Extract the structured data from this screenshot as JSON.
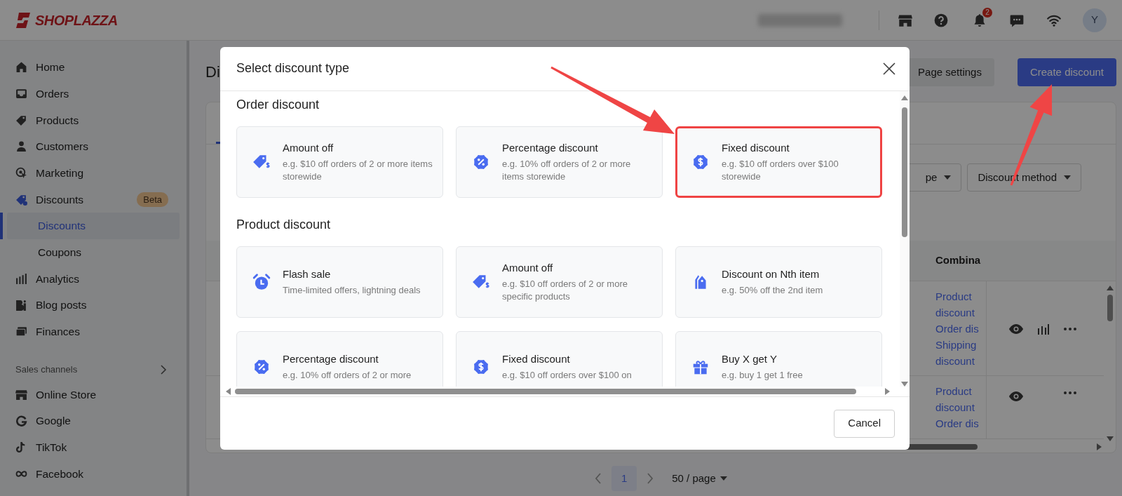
{
  "topbar": {
    "logo": "SHOPLAZZA",
    "notification_count": "2",
    "avatar": "Y"
  },
  "sidebar": {
    "items": [
      {
        "label": "Home",
        "selected": false
      },
      {
        "label": "Orders",
        "selected": false
      },
      {
        "label": "Products",
        "selected": false
      },
      {
        "label": "Customers",
        "selected": false
      },
      {
        "label": "Marketing",
        "selected": false
      },
      {
        "label": "Discounts",
        "selected": false,
        "badge": "Beta",
        "children": [
          {
            "label": "Discounts",
            "selected": true
          },
          {
            "label": "Coupons",
            "selected": false
          }
        ]
      },
      {
        "label": "Analytics",
        "selected": false
      },
      {
        "label": "Blog posts",
        "selected": false
      },
      {
        "label": "Finances",
        "selected": false
      }
    ],
    "sections": [
      {
        "title": "Sales channels",
        "items": [
          {
            "label": "Online Store",
            "selected": false
          },
          {
            "label": "Google",
            "selected": false
          },
          {
            "label": "TikTok",
            "selected": false
          },
          {
            "label": "Facebook",
            "selected": false
          }
        ]
      }
    ]
  },
  "page": {
    "title": "Di",
    "buttons": [
      {
        "label": "Page settings",
        "kind": "secondary"
      },
      {
        "label": "Create discount",
        "kind": "primary"
      }
    ],
    "filters": [
      {
        "label": "pe"
      },
      {
        "label": "Discount method"
      }
    ],
    "table": {
      "columns": [
        "Combina"
      ],
      "rows": [
        {
          "lines": [
            "Product",
            "discount",
            "Order dis",
            "Shipping",
            "discount"
          ],
          "stats": true
        },
        {
          "lines": [
            "Product",
            "discount",
            "Order dis"
          ],
          "stats": false
        }
      ]
    },
    "pagination": {
      "pages": [
        {
          "label": "1",
          "selected": true
        }
      ],
      "page_size": "50 / page"
    }
  },
  "modal": {
    "title": "Select discount type",
    "sections": [
      {
        "heading": "Order discount",
        "options": [
          {
            "title": "Amount off",
            "description": "e.g. $10 off orders of 2 or more items storewide",
            "highlighted": false
          },
          {
            "title": "Percentage discount",
            "description": "e.g. 10% off orders of 2 or more items storewide",
            "highlighted": false
          },
          {
            "title": "Fixed discount",
            "description": "e.g. $10 off orders over $100 storewide",
            "highlighted": true
          }
        ]
      },
      {
        "heading": "Product discount",
        "options": [
          {
            "title": "Flash sale",
            "description": "Time-limited offers, lightning deals",
            "highlighted": false
          },
          {
            "title": "Amount off",
            "description": "e.g. $10 off orders of 2 or more specific products",
            "highlighted": false
          },
          {
            "title": "Discount on Nth item",
            "description": "e.g. 50% off the 2nd item",
            "highlighted": false
          },
          {
            "title": "Percentage discount",
            "description": "e.g. 10% off orders of 2 or more",
            "highlighted": false
          },
          {
            "title": "Fixed discount",
            "description": "e.g. $10 off orders over $100 on",
            "highlighted": false
          },
          {
            "title": "Buy X get Y",
            "description": "e.g. buy 1 get 1 free",
            "highlighted": false
          }
        ]
      }
    ],
    "buttons": [
      "Cancel"
    ]
  }
}
